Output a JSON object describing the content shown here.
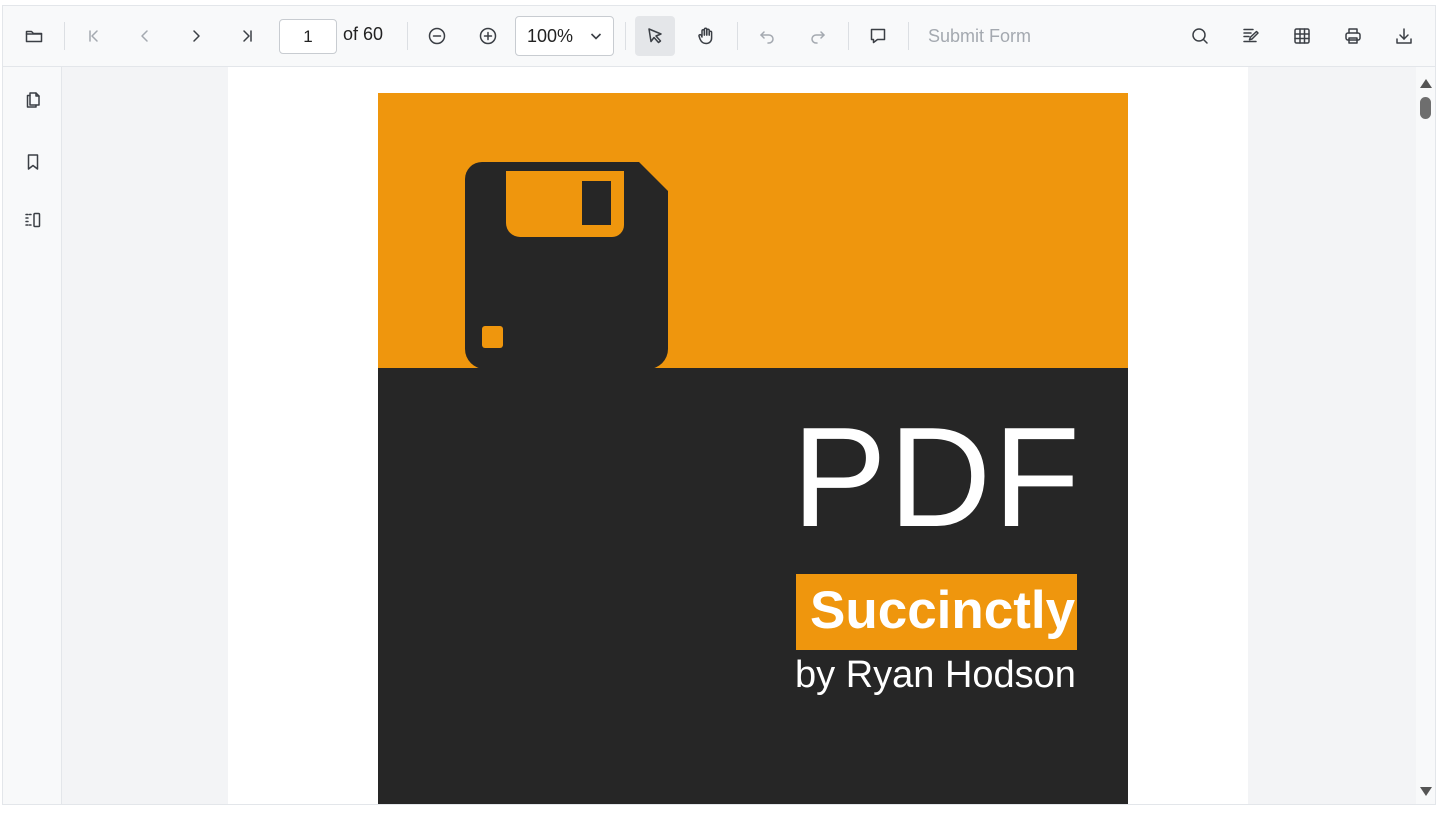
{
  "toolbar": {
    "open": {
      "icon": "folder-open-icon"
    },
    "first_page": {
      "icon": "first-page-icon"
    },
    "prev_page": {
      "icon": "chevron-left-icon"
    },
    "next_page": {
      "icon": "chevron-right-icon"
    },
    "last_page": {
      "icon": "last-page-icon"
    },
    "current_page": "1",
    "total_pages_text": "of 60",
    "zoom_out": {
      "icon": "zoom-out-icon"
    },
    "zoom_in": {
      "icon": "zoom-in-icon"
    },
    "zoom_value": "100%",
    "select_tool": {
      "icon": "cursor-icon",
      "active": true
    },
    "pan_tool": {
      "icon": "hand-icon"
    },
    "undo": {
      "icon": "undo-icon"
    },
    "redo": {
      "icon": "redo-icon"
    },
    "comment": {
      "icon": "comment-icon"
    },
    "submit_form_label": "Submit Form",
    "search": {
      "icon": "search-icon"
    },
    "annotate": {
      "icon": "annotation-edit-icon"
    },
    "form_designer": {
      "icon": "form-grid-icon"
    },
    "print": {
      "icon": "print-icon"
    },
    "download": {
      "icon": "download-icon"
    }
  },
  "sidebar": {
    "items": [
      {
        "icon": "page-thumbnails-icon"
      },
      {
        "icon": "bookmark-icon"
      },
      {
        "icon": "organize-pages-icon"
      }
    ]
  },
  "document": {
    "cover_title": "PDF",
    "cover_series": "Succinctly",
    "cover_author": "by Ryan Hodson"
  },
  "colors": {
    "cover_orange": "#EF960D",
    "cover_dark": "#262626",
    "toolbar_bg": "#F8F9FA",
    "viewer_bg": "#F3F4F6"
  }
}
